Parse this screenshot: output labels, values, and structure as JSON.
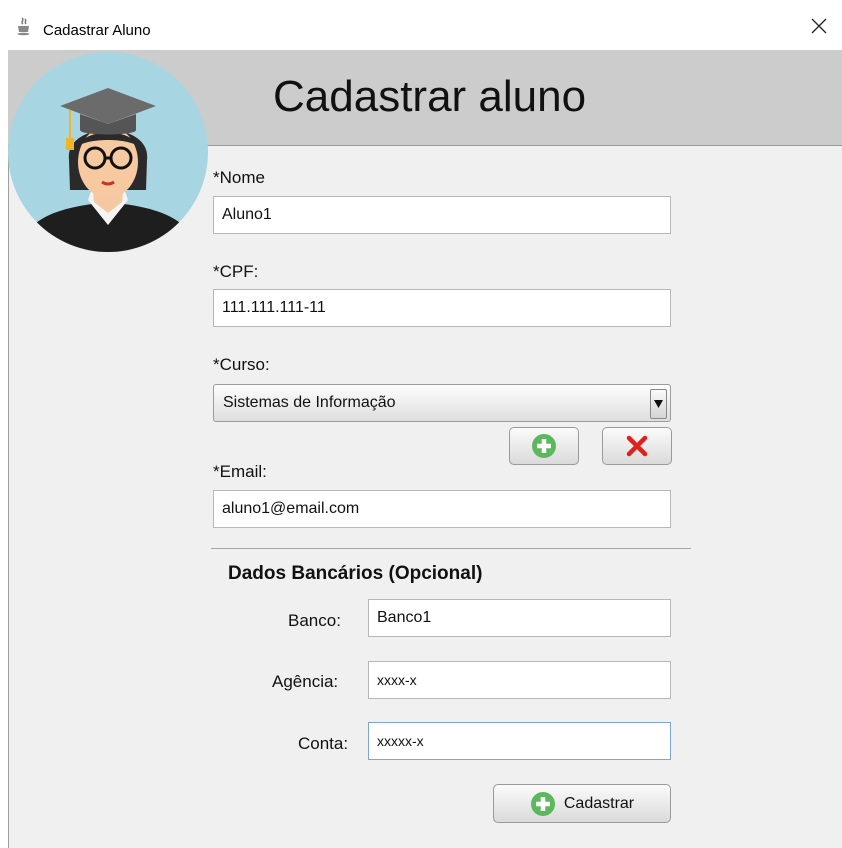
{
  "window": {
    "title": "Cadastrar Aluno"
  },
  "header": {
    "title": "Cadastrar aluno"
  },
  "form": {
    "nome": {
      "label": "*Nome",
      "value": "Aluno1"
    },
    "cpf": {
      "label": "*CPF:",
      "value": "111.111.111-11"
    },
    "curso": {
      "label": "*Curso:",
      "selected": "Sistemas de Informação"
    },
    "email": {
      "label": "*Email:",
      "value": "aluno1@email.com"
    }
  },
  "bank": {
    "section_title": "Dados Bancários (Opcional)",
    "banco": {
      "label": "Banco:",
      "value": "Banco1"
    },
    "agencia": {
      "label": "Agência:",
      "value": "xxxx-x"
    },
    "conta": {
      "label": "Conta:",
      "value": "xxxxx-x"
    }
  },
  "actions": {
    "submit_label": "Cadastrar"
  },
  "icons": {
    "window": "java-cup-icon",
    "close": "close-icon",
    "add": "plus-circle-icon",
    "remove": "red-x-icon",
    "dropdown": "triangle-down-icon"
  },
  "colors": {
    "add_green": "#5cb85c",
    "remove_red": "#e0201b",
    "avatar_bg": "#a8d5e2"
  }
}
